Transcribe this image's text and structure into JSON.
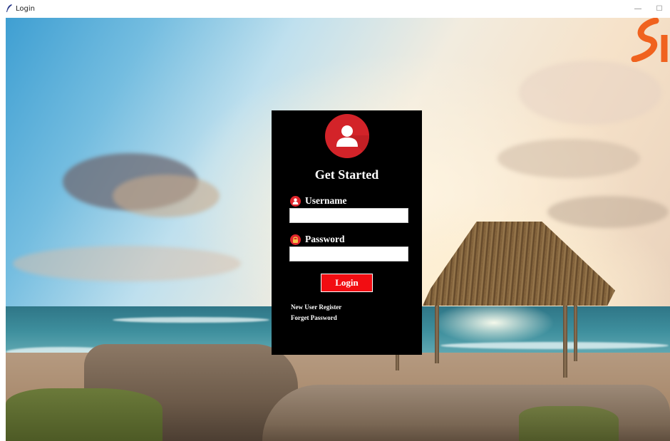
{
  "window": {
    "title": "Login",
    "minimize_glyph": "—",
    "maximize_glyph": "☐"
  },
  "login": {
    "heading": "Get Started",
    "username_label": "Username",
    "username_value": "",
    "password_label": "Password",
    "password_value": "",
    "login_button": "Login",
    "register_link": "New User Register",
    "forgot_link": "Forget Password"
  },
  "icons": {
    "app": "feather-icon",
    "avatar": "user-icon",
    "username": "user-icon",
    "password": "lock-icon"
  },
  "colors": {
    "panel": "#000000",
    "accent": "#d32329",
    "button": "#f20d12",
    "brand": "#f0621e"
  }
}
